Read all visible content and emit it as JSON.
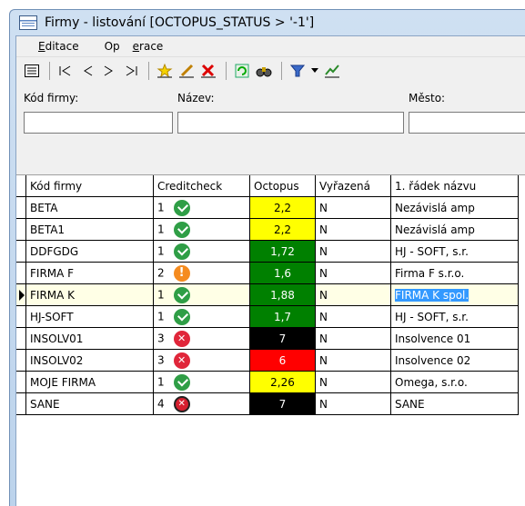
{
  "window": {
    "title": "Firmy - listování [OCTOPUS_STATUS > '-1']"
  },
  "menu": {
    "items": [
      {
        "prefix": "",
        "accel": "E",
        "rest": "ditace"
      },
      {
        "prefix": "Op",
        "accel": "e",
        "rest": "race"
      }
    ]
  },
  "filters": {
    "kod_label": "Kód firmy:",
    "nazev_label": "Název:",
    "mesto_label": "Město:",
    "kod_value": "",
    "nazev_value": "",
    "mesto_value": ""
  },
  "grid": {
    "columns": [
      "Kód firmy",
      "Creditcheck",
      "Octopus",
      "Vyřazená",
      "1. řádek názvu"
    ],
    "rows": [
      {
        "kod": "BETA",
        "cc": "1",
        "status": "ok",
        "octopus": "2,2",
        "octopus_bg": "#ffff00",
        "octopus_fg": "#000000",
        "vyrazena": "N",
        "nazev": "Nezávislá amp"
      },
      {
        "kod": "BETA1",
        "cc": "1",
        "status": "ok",
        "octopus": "2,2",
        "octopus_bg": "#ffff00",
        "octopus_fg": "#000000",
        "vyrazena": "N",
        "nazev": "Nezávislá amp"
      },
      {
        "kod": "DDFGDG",
        "cc": "1",
        "status": "ok",
        "octopus": "1,72",
        "octopus_bg": "#008000",
        "octopus_fg": "#ffffff",
        "vyrazena": "N",
        "nazev": "HJ - SOFT, s.r."
      },
      {
        "kod": "FIRMA F",
        "cc": "2",
        "status": "warn",
        "octopus": "1,6",
        "octopus_bg": "#008000",
        "octopus_fg": "#ffffff",
        "vyrazena": "N",
        "nazev": "Firma F s.r.o."
      },
      {
        "kod": "FIRMA K",
        "cc": "1",
        "status": "ok",
        "octopus": "1,88",
        "octopus_bg": "#008000",
        "octopus_fg": "#ffffff",
        "vyrazena": "N",
        "nazev": "FIRMA K spol.",
        "current": true
      },
      {
        "kod": "HJ-SOFT",
        "cc": "1",
        "status": "ok",
        "octopus": "1,7",
        "octopus_bg": "#008000",
        "octopus_fg": "#ffffff",
        "vyrazena": "N",
        "nazev": "HJ - SOFT, s.r."
      },
      {
        "kod": "INSOLV01",
        "cc": "3",
        "status": "err",
        "octopus": "7",
        "octopus_bg": "#000000",
        "octopus_fg": "#ffffff",
        "vyrazena": "N",
        "nazev": "Insolvence 01"
      },
      {
        "kod": "INSOLV02",
        "cc": "3",
        "status": "err",
        "octopus": "6",
        "octopus_bg": "#ff0000",
        "octopus_fg": "#ffffff",
        "vyrazena": "N",
        "nazev": "Insolvence 02"
      },
      {
        "kod": "MOJE FIRMA",
        "cc": "1",
        "status": "ok",
        "octopus": "2,26",
        "octopus_bg": "#ffff00",
        "octopus_fg": "#000000",
        "vyrazena": "N",
        "nazev": "Omega, s.r.o."
      },
      {
        "kod": "SANE",
        "cc": "4",
        "status": "bad",
        "octopus": "7",
        "octopus_bg": "#000000",
        "octopus_fg": "#ffffff",
        "vyrazena": "N",
        "nazev": "SANE"
      }
    ]
  }
}
